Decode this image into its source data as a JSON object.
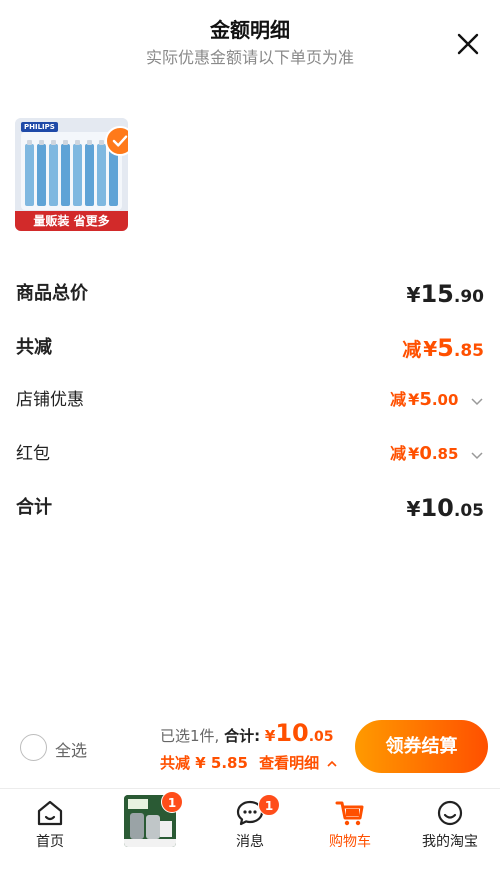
{
  "header": {
    "title": "金额明细",
    "subtitle": "实际优惠金额请以下单页为准"
  },
  "product": {
    "brand": "PHILIPS",
    "badge": "量贩装 省更多"
  },
  "rows": {
    "total_price": {
      "label": "商品总价",
      "yen": "¥",
      "int": "15",
      "dec": ".90"
    },
    "total_reduce": {
      "label": "共减",
      "prefix": "减",
      "yen": "¥",
      "int": "5",
      "dec": ".85"
    },
    "shop_discount": {
      "label": "店铺优惠",
      "prefix": "减",
      "yen": "¥",
      "int": "5",
      "dec": ".00"
    },
    "red_packet": {
      "label": "红包",
      "prefix": "减",
      "yen": "¥",
      "int": "0",
      "dec": ".85"
    },
    "sum": {
      "label": "合计",
      "yen": "¥",
      "int": "10",
      "dec": ".05"
    }
  },
  "actionbar": {
    "select_all": "全选",
    "selected": "已选1件,",
    "total_label": "合计:",
    "total_yen": "¥",
    "total_int": "10",
    "total_dec": ".05",
    "reduce_text": "共减 ¥ 5.85",
    "detail_link": "查看明细",
    "cta": "领券结算"
  },
  "tabbar": {
    "home": "首页",
    "messages": "消息",
    "cart": "购物车",
    "mine": "我的淘宝",
    "promo_badge": "1",
    "messages_badge": "1"
  },
  "colors": {
    "accent": "#ff5000",
    "accent_gradient_start": "#ff9a00",
    "badge_red": "#ff4d1a"
  }
}
